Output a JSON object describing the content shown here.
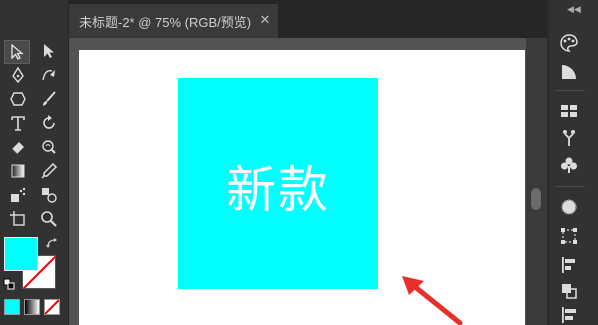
{
  "document": {
    "tab_title": "未标题-2* @ 75% (RGB/预览)",
    "close_glyph": "✕"
  },
  "artboard": {
    "shape_fill": "#00ffff",
    "text": "新款",
    "text_color": "#ffffff"
  },
  "toolbar": {
    "fill_color": "#00ffff",
    "stroke_color": "none",
    "tools": [
      "selection-tool-icon",
      "direct-selection-tool-icon",
      "pen-tool-icon",
      "curvature-tool-icon",
      "shape-tool-icon",
      "paintbrush-tool-icon",
      "type-tool-icon",
      "rotate-tool-icon",
      "eraser-tool-icon",
      "warp-tool-icon",
      "gradient-tool-icon",
      "eyedropper-tool-icon",
      "symbol-sprayer-tool-icon",
      "blend-tool-icon",
      "artboard-tool-icon",
      "zoom-tool-icon"
    ]
  },
  "annotation": {
    "arrow_color": "#e8302a"
  },
  "panels": {
    "icons": [
      "color-icon",
      "color-guide-icon",
      "swatches-icon",
      "brushes-icon",
      "symbols-icon",
      "appearance-icon",
      "transform-icon",
      "align-icon",
      "pathfinder-icon",
      "transparency-icon"
    ]
  }
}
